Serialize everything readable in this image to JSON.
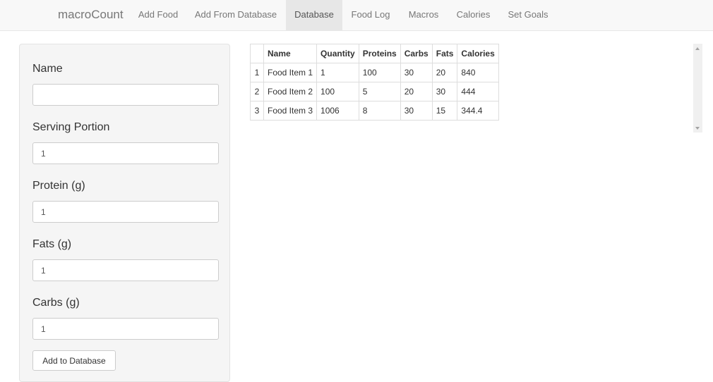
{
  "brand": "macroCount",
  "nav": [
    {
      "label": "Add Food",
      "active": false
    },
    {
      "label": "Add From Database",
      "active": false
    },
    {
      "label": "Database",
      "active": true
    },
    {
      "label": "Food Log",
      "active": false
    },
    {
      "label": "Macros",
      "active": false
    },
    {
      "label": "Calories",
      "active": false
    },
    {
      "label": "Set Goals",
      "active": false
    }
  ],
  "form": {
    "name_label": "Name",
    "name_value": "",
    "serving_label": "Serving Portion",
    "serving_value": "1",
    "protein_label": "Protein (g)",
    "protein_value": "1",
    "fats_label": "Fats (g)",
    "fats_value": "1",
    "carbs_label": "Carbs (g)",
    "carbs_value": "1",
    "submit_label": "Add to Database"
  },
  "table": {
    "headers": [
      "",
      "Name",
      "Quantity",
      "Proteins",
      "Carbs",
      "Fats",
      "Calories"
    ],
    "rows": [
      [
        "1",
        "Food Item 1",
        "1",
        "100",
        "30",
        "20",
        "840"
      ],
      [
        "2",
        "Food Item 2",
        "100",
        "5",
        "20",
        "30",
        "444"
      ],
      [
        "3",
        "Food Item 3",
        "1006",
        "8",
        "30",
        "15",
        "344.4"
      ]
    ]
  }
}
